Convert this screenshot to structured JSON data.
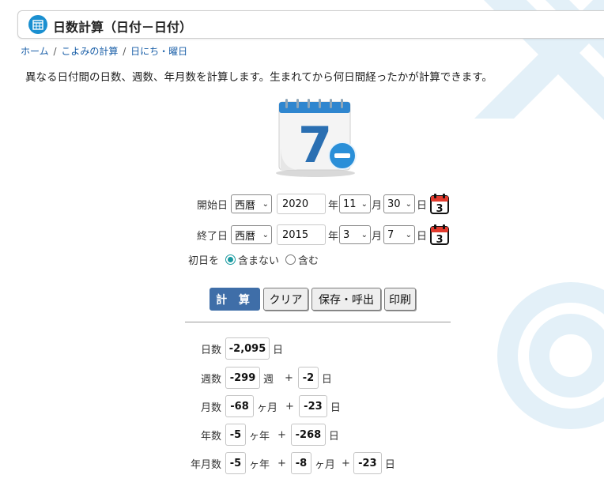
{
  "title": "日数計算（日付－日付）",
  "breadcrumb": {
    "home": "ホーム",
    "sep": "/",
    "cat": "こよみの計算",
    "sub": "日にち・曜日"
  },
  "description": "異なる日付間の日数、週数、年月数を計算します。生まれてから何日間経ったかが計算できます。",
  "hero": {
    "number": "7"
  },
  "form": {
    "start": {
      "label": "開始日",
      "era": "西暦",
      "year": "2020",
      "year_unit": "年",
      "month": "11",
      "month_unit": "月",
      "day": "30",
      "day_unit": "日"
    },
    "end": {
      "label": "終了日",
      "era": "西暦",
      "year": "2015",
      "year_unit": "年",
      "month": "3",
      "month_unit": "月",
      "day": "7",
      "day_unit": "日"
    },
    "calendar_icon_day": "3",
    "first_day": {
      "label": "初日を",
      "options": [
        "含まない",
        "含む"
      ],
      "selected": "含まない"
    }
  },
  "buttons": {
    "calc": "計 算",
    "clear": "クリア",
    "save": "保存・呼出",
    "print": "印刷"
  },
  "results": {
    "days": {
      "label": "日数",
      "value": "-2,095",
      "unit": "日"
    },
    "weeks": {
      "label": "週数",
      "value": "-299",
      "unit": "週",
      "plus": "+",
      "rem": "-2",
      "rem_unit": "日"
    },
    "months": {
      "label": "月数",
      "value": "-68",
      "unit": "ヶ月",
      "plus": "+",
      "rem": "-23",
      "rem_unit": "日"
    },
    "years": {
      "label": "年数",
      "value": "-5",
      "unit": "ヶ年",
      "plus": "+",
      "rem": "-268",
      "rem_unit": "日"
    },
    "ymd": {
      "label": "年月数",
      "y": "-5",
      "y_unit": "ヶ年",
      "plus": "+",
      "m": "-8",
      "m_unit": "ヶ月",
      "plus2": "+",
      "d": "-23",
      "d_unit": "日"
    }
  },
  "colors": {
    "primary_button": "#3f6ea8",
    "title_icon": "#1a8fd0",
    "radio": "#1a9aa0",
    "hero_minus": "#2a8fd8"
  }
}
